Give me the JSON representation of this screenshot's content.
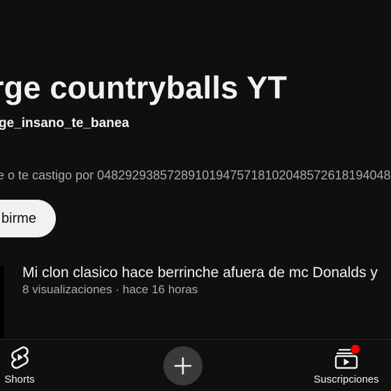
{
  "channel": {
    "name": "rge countryballs YT",
    "handle": "ge_insano_te_banea",
    "description": "e o te castigo por 048292938572891019475718102048572618194048"
  },
  "subscribe_button": {
    "label": "birme"
  },
  "video": {
    "title": "Mi clon clasico hace berrinche afuera de mc Donalds y",
    "meta": "8 visualizaciones · hace 16 horas"
  },
  "bottom_nav": {
    "shorts_label": "Shorts",
    "create_icon": "plus-icon",
    "subscriptions_label": "Suscripciones",
    "notification_color": "#ff0000"
  },
  "colors": {
    "background": "#0f0f0f",
    "text_primary": "#f1f1f1",
    "text_secondary": "#aaaaaa"
  }
}
